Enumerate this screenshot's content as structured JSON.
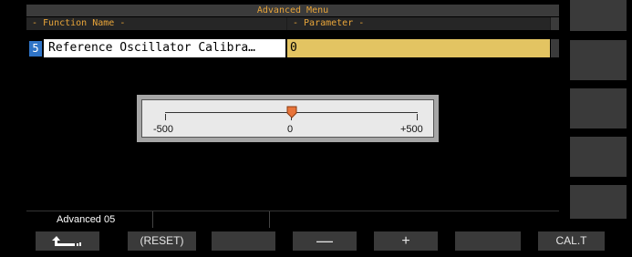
{
  "menu": {
    "title": "Advanced Menu",
    "col_function": "- Function Name -",
    "col_parameter": "- Parameter -"
  },
  "row": {
    "number": "5",
    "function_name": "Reference Oscillator Calibra…",
    "parameter": "0"
  },
  "slider": {
    "min_label": "-500",
    "mid_label": "0",
    "max_label": "+500",
    "value": 0,
    "min": -500,
    "max": 500
  },
  "status": {
    "page": "Advanced 05",
    "b": "",
    "c": ""
  },
  "softkeys": {
    "back_icon": "back-arrow-icon",
    "reset": "(RESET)",
    "k3": "",
    "minus": "—",
    "plus": "+",
    "k6": "",
    "calt": "CAL.T"
  },
  "colors": {
    "title": "#e8a53a",
    "param_highlight": "#e3c462",
    "row_number_bg": "#2f74c7",
    "thumb": "#e8743a"
  }
}
